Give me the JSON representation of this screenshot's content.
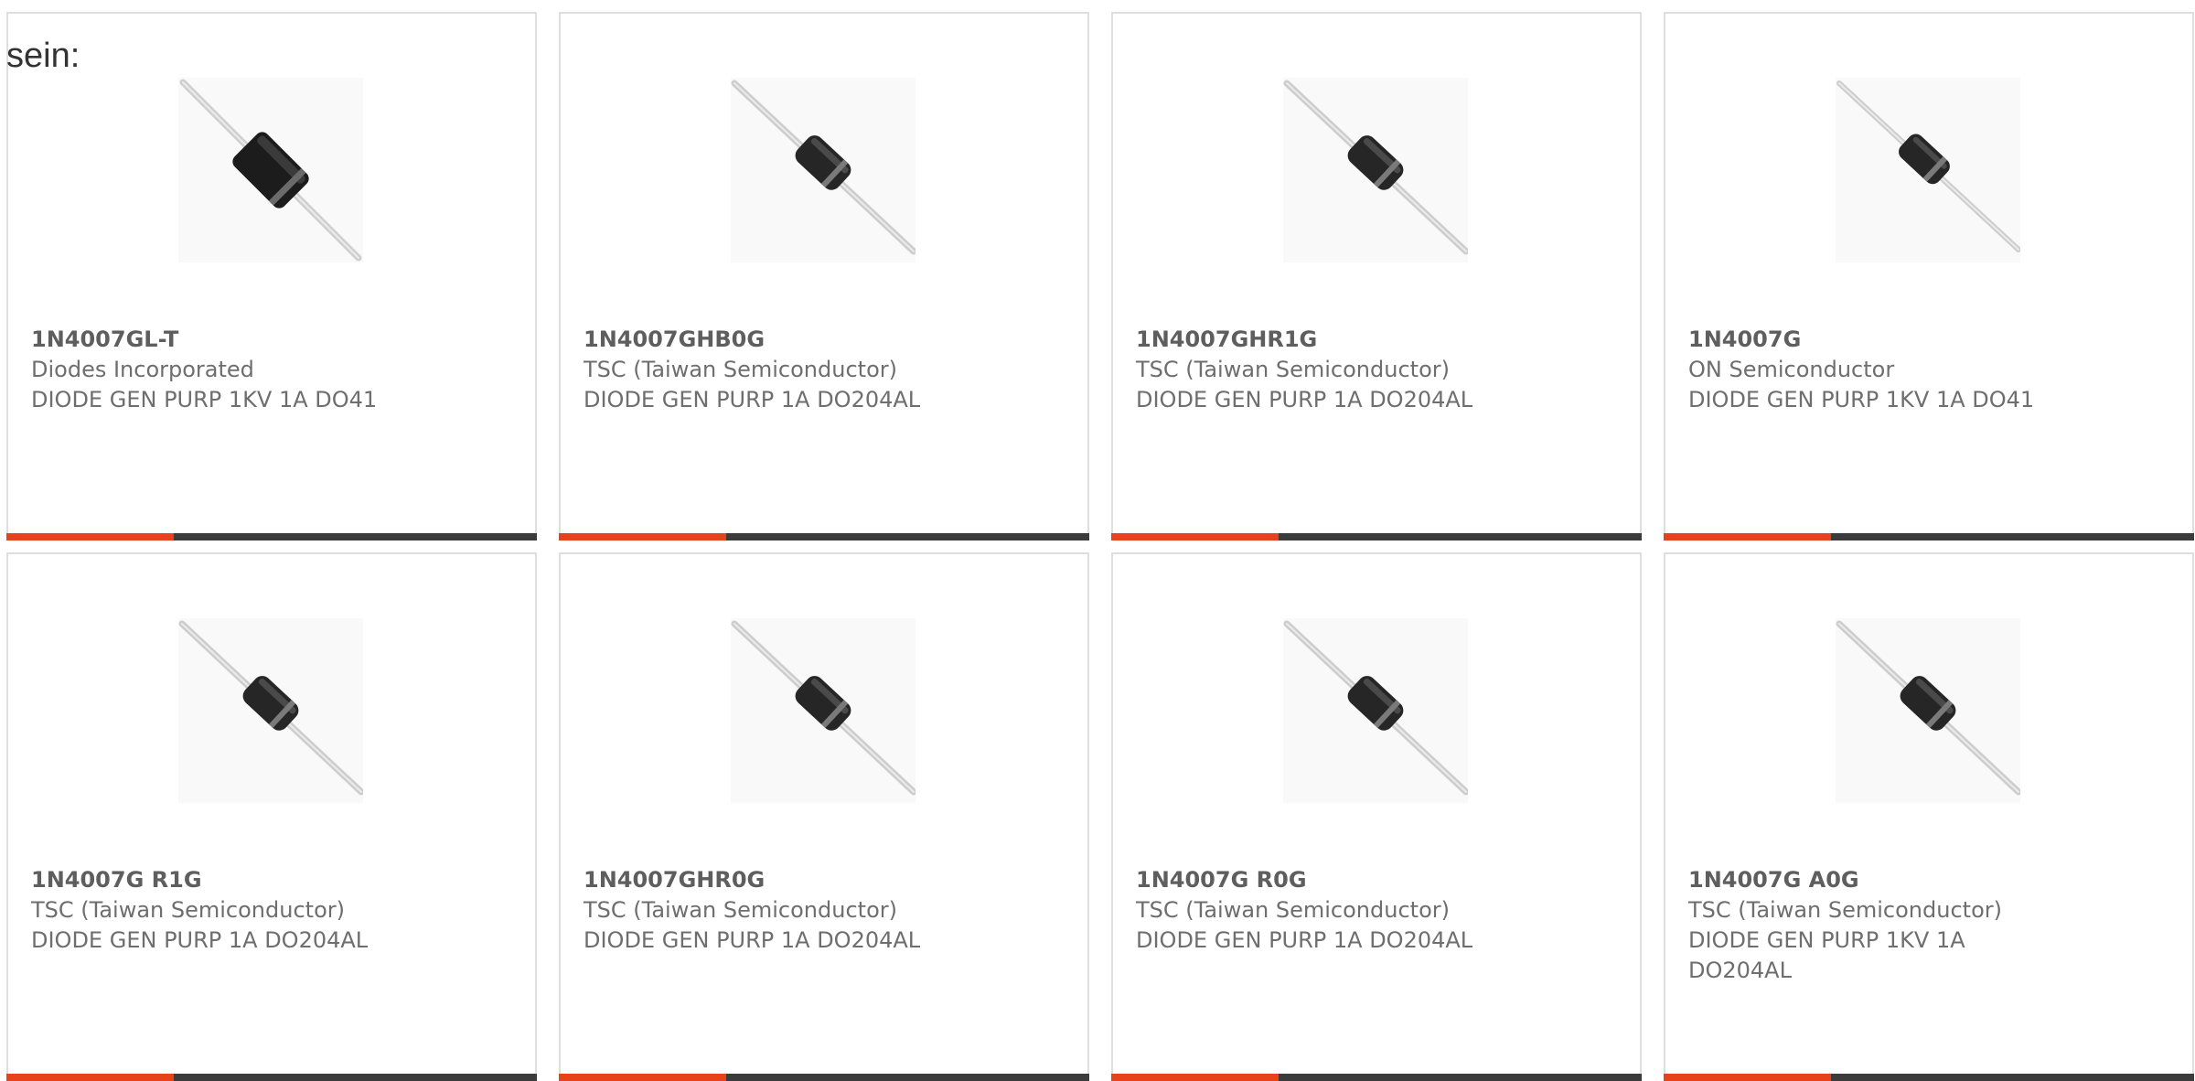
{
  "intro": {
    "text": "sein:"
  },
  "colors": {
    "accent": "#e8421a",
    "bar_dark": "#3b3b3b",
    "card_border": "#dedede",
    "text": "#6e6e6e"
  },
  "products": [
    {
      "part_number": "1N4007GL-T",
      "manufacturer": "Diodes Incorporated",
      "description": "DIODE GEN PURP 1KV 1A DO41",
      "image_icon": "diode-do41-large-image"
    },
    {
      "part_number": "1N4007GHB0G",
      "manufacturer": "TSC (Taiwan Semiconductor)",
      "description": "DIODE GEN PURP 1A DO204AL",
      "image_icon": "diode-do204al-image"
    },
    {
      "part_number": "1N4007GHR1G",
      "manufacturer": "TSC (Taiwan Semiconductor)",
      "description": "DIODE GEN PURP 1A DO204AL",
      "image_icon": "diode-do204al-image"
    },
    {
      "part_number": "1N4007G",
      "manufacturer": "ON Semiconductor",
      "description": "DIODE GEN PURP 1KV 1A DO41",
      "image_icon": "diode-do41-image"
    },
    {
      "part_number": "1N4007G R1G",
      "manufacturer": "TSC (Taiwan Semiconductor)",
      "description": "DIODE GEN PURP 1A DO204AL",
      "image_icon": "diode-do204al-image"
    },
    {
      "part_number": "1N4007GHR0G",
      "manufacturer": "TSC (Taiwan Semiconductor)",
      "description": "DIODE GEN PURP 1A DO204AL",
      "image_icon": "diode-do204al-image"
    },
    {
      "part_number": "1N4007G R0G",
      "manufacturer": "TSC (Taiwan Semiconductor)",
      "description": "DIODE GEN PURP 1A DO204AL",
      "image_icon": "diode-do204al-image"
    },
    {
      "part_number": "1N4007G A0G",
      "manufacturer": "TSC (Taiwan Semiconductor)",
      "description": "DIODE GEN PURP 1KV 1A DO204AL",
      "image_icon": "diode-do204al-image"
    }
  ]
}
